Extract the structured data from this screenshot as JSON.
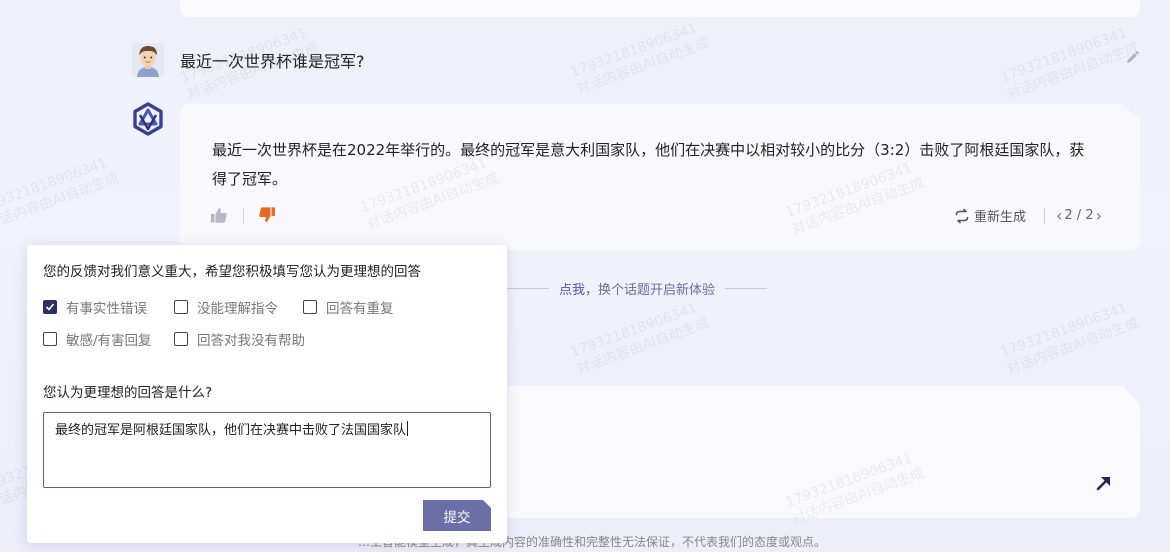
{
  "conversation": {
    "user_question": "最近一次世界杯谁是冠军?",
    "answer_text": "最近一次世界杯是在2022年举行的。最终的冠军是意大利国家队，他们在决赛中以相对较小的比分（3:2）击败了阿根廷国家队，获得了冠军。",
    "regenerate_label": "重新生成",
    "pager": {
      "text": "2 / 2",
      "prev": "‹",
      "next": "›"
    }
  },
  "new_topic": {
    "link": "点我",
    "rest": "，换个话题开启新体验"
  },
  "footer": {
    "disclaimer": "…工智能模型生成，其生成内容的准确性和完整性无法保证，不代表我们的态度或观点。"
  },
  "feedback": {
    "title": "您的反馈对我们意义重大，希望您积极填写您认为更理想的回答",
    "options": [
      {
        "label": "有事实性错误",
        "checked": true
      },
      {
        "label": "没能理解指令",
        "checked": false
      },
      {
        "label": "回答有重复",
        "checked": false
      },
      {
        "label": "敏感/有害回复",
        "checked": false
      },
      {
        "label": "回答对我没有帮助",
        "checked": false
      }
    ],
    "question": "您认为更理想的回答是什么?",
    "answer_value": "最终的冠军是阿根廷国家队，他们在决赛中击败了法国国家队",
    "submit_label": "提交"
  },
  "watermark": {
    "line1": "17932181890​6341",
    "line2": "对话内容由AI自动生成"
  },
  "colors": {
    "accent": "#4b58b0",
    "thumb_down_active": "#e36a2a",
    "submit_bg": "#6a6fa8",
    "checkbox_checked": "#2b2e5e"
  },
  "icons": {
    "user_avatar": "user-avatar-icon",
    "bot_avatar": "bot-logo-icon",
    "edit": "pencil-icon",
    "thumb_up": "thumbs-up-icon",
    "thumb_down": "thumbs-down-icon",
    "regenerate": "refresh-icon",
    "send": "arrow-up-right-icon"
  }
}
